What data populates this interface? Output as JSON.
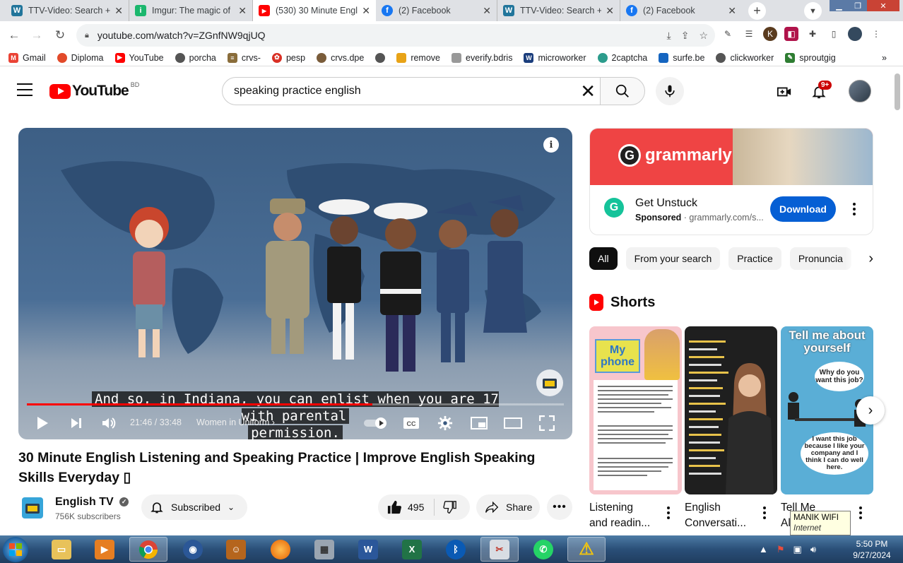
{
  "browser": {
    "tabs": [
      {
        "title": "TTV-Video: Search +",
        "icon": "wordpress-icon",
        "color": "#21759b",
        "glyph": "W"
      },
      {
        "title": "Imgur: The magic of",
        "icon": "imgur-icon",
        "color": "#1bb76e",
        "glyph": "i"
      },
      {
        "title": "(530) 30 Minute Engl",
        "icon": "youtube-icon",
        "color": "#ff0000",
        "glyph": "▶"
      },
      {
        "title": "(2) Facebook",
        "icon": "facebook-icon",
        "color": "#1877f2",
        "glyph": "f"
      },
      {
        "title": "TTV-Video: Search +",
        "icon": "wordpress-icon",
        "color": "#21759b",
        "glyph": "W"
      },
      {
        "title": "(2) Facebook",
        "icon": "facebook-icon",
        "color": "#1877f2",
        "glyph": "f"
      }
    ],
    "active_tab": 2,
    "url": "youtube.com/watch?v=ZGnfNW9qjUQ",
    "bookmarks": [
      {
        "label": "Gmail",
        "color": "#ea4335",
        "glyph": "M"
      },
      {
        "label": "Diploma",
        "color": "#e24a2a",
        "glyph": "●"
      },
      {
        "label": "YouTube",
        "color": "#ff0000",
        "glyph": "▶"
      },
      {
        "label": "porcha",
        "color": "#555555",
        "glyph": "◐"
      },
      {
        "label": "crvs-",
        "color": "#8a6d3b",
        "glyph": "≡"
      },
      {
        "label": "pesp",
        "color": "#d93025",
        "glyph": "✿"
      },
      {
        "label": "crvs.dpe",
        "color": "#7a5c3a",
        "glyph": "◎"
      },
      {
        "label": "",
        "color": "#555555",
        "glyph": "◐"
      },
      {
        "label": "remove",
        "color": "#e8a317",
        "glyph": "▬"
      },
      {
        "label": "everify.bdris",
        "color": "#888888",
        "glyph": "▤"
      },
      {
        "label": "microworker",
        "color": "#1a3d7c",
        "glyph": "W"
      },
      {
        "label": "2captcha",
        "color": "#2c9c8c",
        "glyph": "◈"
      },
      {
        "label": "surfe.be",
        "color": "#1565c0",
        "glyph": "■"
      },
      {
        "label": "clickworker",
        "color": "#555555",
        "glyph": "◐"
      },
      {
        "label": "sproutgig",
        "color": "#2e7d32",
        "glyph": "✎"
      }
    ]
  },
  "youtube": {
    "logo_text": "YouTube",
    "region": "BD",
    "search_value": "speaking practice english",
    "notifications_badge": "9+"
  },
  "video": {
    "subtitle_line1": "And so, in Indiana, you can enlist when you are 17 with parental",
    "subtitle_line2": "permission.",
    "current_time": "21:46 / 33:48",
    "chapter": "Women in Uniform",
    "progress": 0.644,
    "title": "30 Minute English Listening and Speaking Practice | Improve English Speaking Skills Everyday ▯",
    "channel_name": "English TV",
    "subscribers": "756K subscribers",
    "subscribe_label": "Subscribed",
    "likes": "495",
    "share_label": "Share"
  },
  "ad": {
    "brand": "grammarly",
    "title": "Get Unstuck",
    "sponsored": "Sponsored",
    "domain": "grammarly.com/s...",
    "cta": "Download"
  },
  "chips": [
    "All",
    "From your search",
    "Practice",
    "Pronuncia"
  ],
  "shorts": {
    "heading": "Shorts",
    "items": [
      {
        "label1": "Listening",
        "label2": "and readin...",
        "thumb_title": "My phone"
      },
      {
        "label1": "English",
        "label2": "Conversati...",
        "thumb_title": ""
      },
      {
        "label1": "Tell Me",
        "label2": "Al",
        "thumb_title": "Tell me about yourself"
      }
    ]
  },
  "tooltip": {
    "line1": "MANIK WIFI",
    "line2": "Internet access"
  },
  "clock": {
    "time": "5:50 PM",
    "date": "9/27/2024"
  }
}
